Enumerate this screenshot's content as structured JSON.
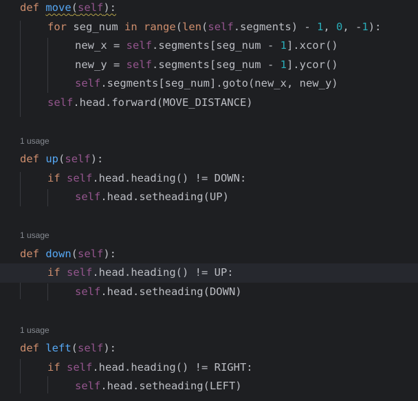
{
  "lines": {
    "l1": [
      "def",
      " ",
      "move",
      "(",
      "self",
      "):"
    ],
    "l2": [
      "for",
      " seg_num ",
      "in",
      " ",
      "range",
      "(",
      "len",
      "(",
      "self",
      ".segments) - ",
      "1",
      ", ",
      "0",
      ", -",
      "1",
      "):"
    ],
    "l3": [
      "new_x = ",
      "self",
      ".segments[seg_num - ",
      "1",
      "].xcor()"
    ],
    "l4": [
      "new_y = ",
      "self",
      ".segments[seg_num - ",
      "1",
      "].ycor()"
    ],
    "l5": [
      "self",
      ".segments[seg_num].goto(new_x, new_y)"
    ],
    "l6": [
      "self",
      ".head.forward(MOVE_DISTANCE)"
    ],
    "usage": "1 usage",
    "l7": [
      "def",
      " ",
      "up",
      "(",
      "self",
      "):"
    ],
    "l8": [
      "if",
      " ",
      "self",
      ".head.heading() != DOWN:"
    ],
    "l9": [
      "self",
      ".head.setheading(UP)"
    ],
    "l10": [
      "def",
      " ",
      "down",
      "(",
      "self",
      "):"
    ],
    "l11": [
      "if",
      " ",
      "self",
      ".head.heading() != UP:"
    ],
    "l12": [
      "self",
      ".head.setheading(DOWN)"
    ],
    "l13": [
      "def",
      " ",
      "left",
      "(",
      "self",
      "):"
    ],
    "l14": [
      "if",
      " ",
      "self",
      ".head.heading() != RIGHT:"
    ],
    "l15": [
      "self",
      ".head.setheading(LEFT)"
    ]
  },
  "colors": {
    "background": "#1e1f22",
    "keyword": "#cf8e6d",
    "function": "#56a8f5",
    "self": "#94558d",
    "number": "#2aacb8",
    "text": "#bcbec4",
    "hint": "#868a91"
  }
}
